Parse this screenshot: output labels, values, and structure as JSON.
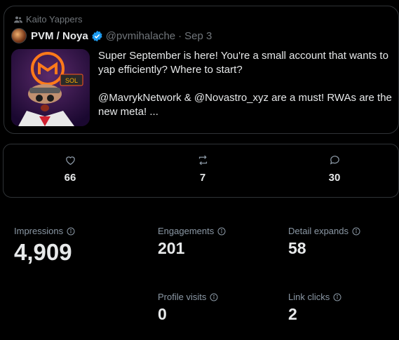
{
  "tweet": {
    "community": "Kaito Yappers",
    "author_name": "PVM / Noya",
    "handle": "@pvmihalache",
    "separator": "·",
    "date": "Sep 3",
    "paragraph1": "Super September is here! You're a small account that wants to yap efficiently? Where to start?",
    "paragraph2": "@MavrykNetwork & @Novastro_xyz are a must! RWAs are the new meta! ...",
    "image_badge": "SOL"
  },
  "engagement": {
    "likes": "66",
    "reposts": "7",
    "replies": "30"
  },
  "metrics": {
    "impressions_label": "Impressions",
    "impressions_value": "4,909",
    "engagements_label": "Engagements",
    "engagements_value": "201",
    "detail_expands_label": "Detail expands",
    "detail_expands_value": "58",
    "profile_visits_label": "Profile visits",
    "profile_visits_value": "0",
    "link_clicks_label": "Link clicks",
    "link_clicks_value": "2"
  },
  "colors": {
    "background": "#000000",
    "text": "#e7e9ea",
    "muted": "#71767b",
    "border": "#2f3336",
    "verified": "#1d9bf0"
  }
}
